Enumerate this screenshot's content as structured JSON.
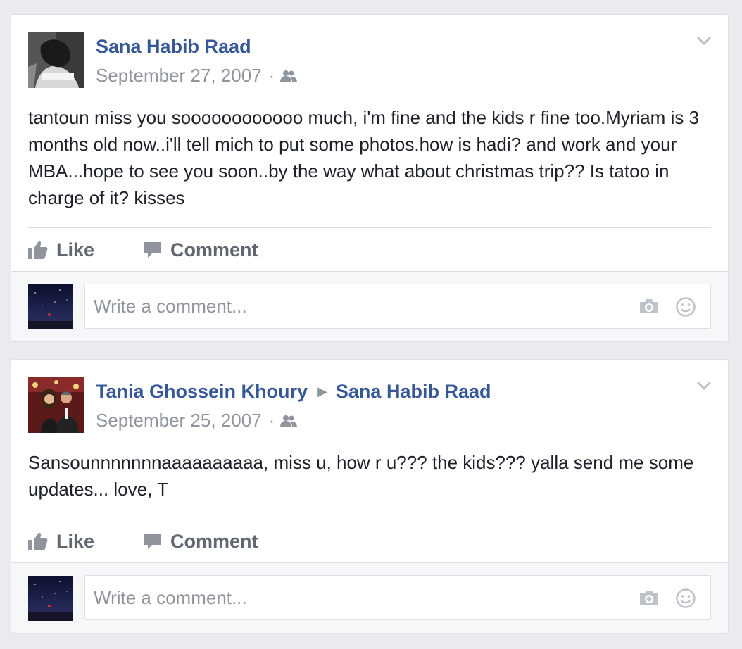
{
  "posts": [
    {
      "author": "Sana Habib Raad",
      "target": "",
      "date": "September 27, 2007",
      "dot": "·",
      "audience_icon": "friends-icon",
      "text": "tantoun miss you soooooooooooo much, i'm fine and the kids r fine too.Myriam is 3 months old now..i'll tell mich to put some photos.how is hadi? and work and your MBA...hope to see you soon..by the way what about christmas trip?? Is tatoo in charge of it? kisses",
      "like_label": "Like",
      "comment_label": "Comment",
      "comment_placeholder": "Write a comment..."
    },
    {
      "author": "Tania Ghossein Khoury",
      "target": "Sana Habib Raad",
      "date": "September 25, 2007",
      "dot": "·",
      "audience_icon": "friends-icon",
      "text": "Sansounnnnnnnaaaaaaaaaa, miss u, how r u??? the kids??? yalla send me some updates... love, T",
      "like_label": "Like",
      "comment_label": "Comment",
      "comment_placeholder": "Write a comment..."
    }
  ],
  "colors": {
    "background": "#e9ebee",
    "name_link": "#365899",
    "meta_text": "#90949c",
    "body_text": "#1d2129",
    "action_text": "#606770"
  }
}
